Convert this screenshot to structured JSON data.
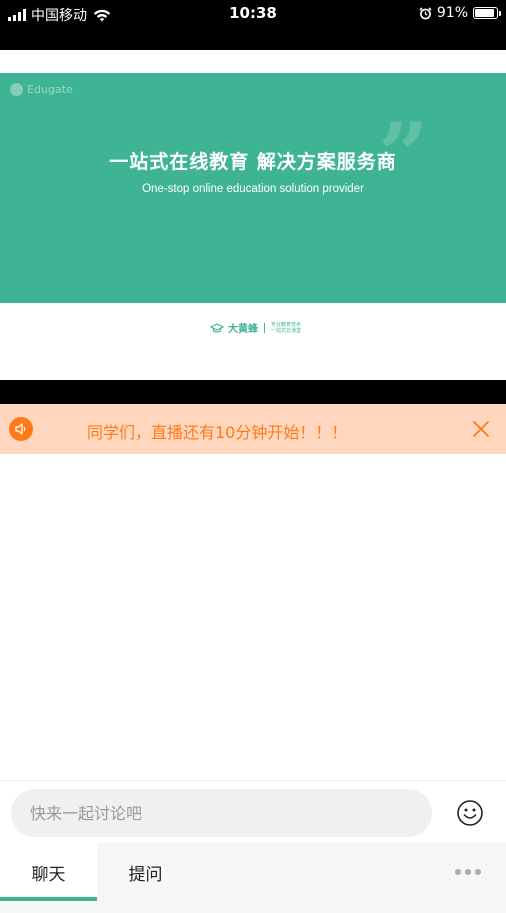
{
  "status_bar": {
    "carrier": "中国移动",
    "time": "10:38",
    "battery": "91%",
    "battery_level": 0.91
  },
  "banner": {
    "watermark": "Edugate",
    "headline": "一站式在线教育 解决方案服务商",
    "subline": "One-stop online education solution provider",
    "brand": "大黄蜂",
    "brand_tagline_1": "专业教育技术",
    "brand_tagline_2": "一站式云课堂"
  },
  "notice": {
    "text": "同学们，直播还有10分钟开始！！！"
  },
  "input": {
    "placeholder": "快来一起讨论吧"
  },
  "tabs": [
    {
      "label": "聊天",
      "active": true
    },
    {
      "label": "提问",
      "active": false
    }
  ],
  "colors": {
    "accent": "#3fb494",
    "notice_bg": "#ffd7bf",
    "notice_text": "#ff7a16"
  }
}
